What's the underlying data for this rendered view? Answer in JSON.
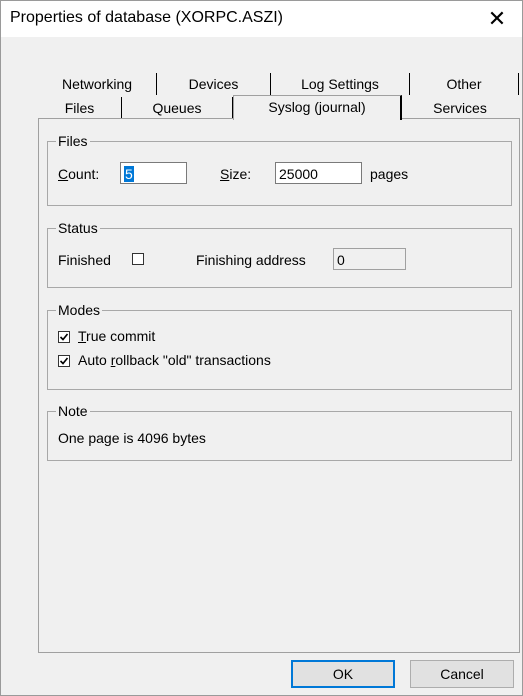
{
  "window": {
    "title": "Properties of database (XORPC.ASZI)",
    "close_glyph": "✕"
  },
  "tabs": {
    "row1": [
      "Networking",
      "Devices",
      "Log Settings",
      "Other"
    ],
    "row2": [
      "Files",
      "Queues",
      "Syslog (journal)",
      "Services"
    ],
    "active": "Syslog (journal)"
  },
  "files_group": {
    "label": "Files",
    "count_label_accel": "C",
    "count_label_rest": "ount:",
    "count_value": "5",
    "size_label_accel": "S",
    "size_label_rest": "ize:",
    "size_value": "25000",
    "size_unit": "pages"
  },
  "status_group": {
    "label": "Status",
    "finished_label": "Finished",
    "finished_checked": false,
    "finishing_address_label": "Finishing address",
    "finishing_address_value": "0"
  },
  "modes_group": {
    "label": "Modes",
    "true_commit_accel": "T",
    "true_commit_rest": "rue commit",
    "true_commit_checked": true,
    "auto_rollback_pre": "Auto ",
    "auto_rollback_accel": "r",
    "auto_rollback_rest": "ollback \"old\" transactions",
    "auto_rollback_checked": true
  },
  "note_group": {
    "label": "Note",
    "text": "One page is 4096 bytes"
  },
  "buttons": {
    "ok": "OK",
    "cancel": "Cancel"
  }
}
